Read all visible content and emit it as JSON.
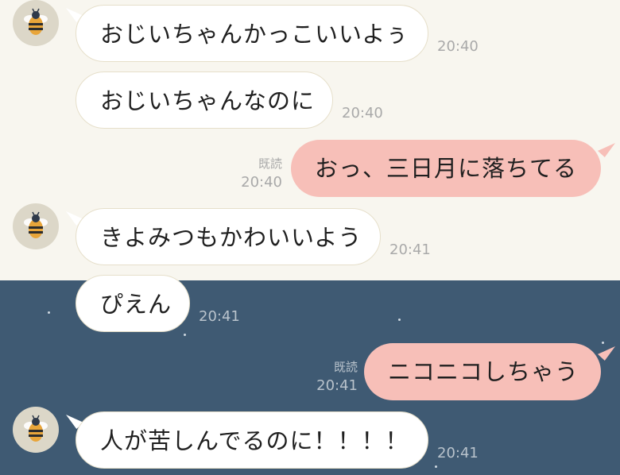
{
  "messages": [
    {
      "text": "おじいちゃんかっこいいよぅ",
      "time": "20:40",
      "sender": "other"
    },
    {
      "text": "おじいちゃんなのに",
      "time": "20:40",
      "sender": "other"
    },
    {
      "text": "おっ、三日月に落ちてる",
      "time": "20:40",
      "sender": "me",
      "read_label": "既読"
    },
    {
      "text": "きよみつもかわいいよう",
      "time": "20:41",
      "sender": "other"
    },
    {
      "text": "ぴえん",
      "time": "20:41",
      "sender": "other"
    },
    {
      "text": "ニコニコしちゃう",
      "time": "20:41",
      "sender": "me",
      "read_label": "既読"
    },
    {
      "text": "人が苦しんでるのに！！！！",
      "time": "20:41",
      "sender": "other"
    }
  ],
  "avatar_icon": "bee-icon",
  "colors": {
    "bg_light": "#f8f6ef",
    "bg_dark": "#3f5a73",
    "bubble_in": "#ffffff",
    "bubble_out": "#f7bfb8",
    "meta_text": "#a9a9a9"
  }
}
